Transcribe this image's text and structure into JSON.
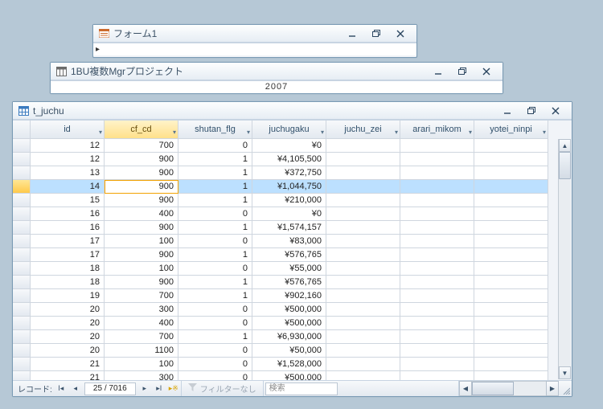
{
  "windows": {
    "form1": {
      "title": "フォーム1"
    },
    "bu": {
      "title": "1BU複数Mgrプロジェクト",
      "stub": "2007"
    },
    "tjuchu": {
      "title": "t_juchu"
    }
  },
  "columns": [
    "id",
    "cf_cd",
    "shutan_flg",
    "juchugaku",
    "juchu_zei",
    "arari_mikom",
    "yotei_ninpi"
  ],
  "active_column_index": 1,
  "selected_row_index": 3,
  "rows": [
    {
      "id": "12",
      "cf_cd": "700",
      "shutan_flg": "0",
      "juchugaku": "¥0",
      "juchu_zei": "",
      "arari_mikom": "",
      "yotei_ninpi": ""
    },
    {
      "id": "12",
      "cf_cd": "900",
      "shutan_flg": "1",
      "juchugaku": "¥4,105,500",
      "juchu_zei": "",
      "arari_mikom": "",
      "yotei_ninpi": ""
    },
    {
      "id": "13",
      "cf_cd": "900",
      "shutan_flg": "1",
      "juchugaku": "¥372,750",
      "juchu_zei": "",
      "arari_mikom": "",
      "yotei_ninpi": ""
    },
    {
      "id": "14",
      "cf_cd": "900",
      "shutan_flg": "1",
      "juchugaku": "¥1,044,750",
      "juchu_zei": "",
      "arari_mikom": "",
      "yotei_ninpi": ""
    },
    {
      "id": "15",
      "cf_cd": "900",
      "shutan_flg": "1",
      "juchugaku": "¥210,000",
      "juchu_zei": "",
      "arari_mikom": "",
      "yotei_ninpi": ""
    },
    {
      "id": "16",
      "cf_cd": "400",
      "shutan_flg": "0",
      "juchugaku": "¥0",
      "juchu_zei": "",
      "arari_mikom": "",
      "yotei_ninpi": ""
    },
    {
      "id": "16",
      "cf_cd": "900",
      "shutan_flg": "1",
      "juchugaku": "¥1,574,157",
      "juchu_zei": "",
      "arari_mikom": "",
      "yotei_ninpi": ""
    },
    {
      "id": "17",
      "cf_cd": "100",
      "shutan_flg": "0",
      "juchugaku": "¥83,000",
      "juchu_zei": "",
      "arari_mikom": "",
      "yotei_ninpi": ""
    },
    {
      "id": "17",
      "cf_cd": "900",
      "shutan_flg": "1",
      "juchugaku": "¥576,765",
      "juchu_zei": "",
      "arari_mikom": "",
      "yotei_ninpi": ""
    },
    {
      "id": "18",
      "cf_cd": "100",
      "shutan_flg": "0",
      "juchugaku": "¥55,000",
      "juchu_zei": "",
      "arari_mikom": "",
      "yotei_ninpi": ""
    },
    {
      "id": "18",
      "cf_cd": "900",
      "shutan_flg": "1",
      "juchugaku": "¥576,765",
      "juchu_zei": "",
      "arari_mikom": "",
      "yotei_ninpi": ""
    },
    {
      "id": "19",
      "cf_cd": "700",
      "shutan_flg": "1",
      "juchugaku": "¥902,160",
      "juchu_zei": "",
      "arari_mikom": "",
      "yotei_ninpi": ""
    },
    {
      "id": "20",
      "cf_cd": "300",
      "shutan_flg": "0",
      "juchugaku": "¥500,000",
      "juchu_zei": "",
      "arari_mikom": "",
      "yotei_ninpi": ""
    },
    {
      "id": "20",
      "cf_cd": "400",
      "shutan_flg": "0",
      "juchugaku": "¥500,000",
      "juchu_zei": "",
      "arari_mikom": "",
      "yotei_ninpi": ""
    },
    {
      "id": "20",
      "cf_cd": "700",
      "shutan_flg": "1",
      "juchugaku": "¥6,930,000",
      "juchu_zei": "",
      "arari_mikom": "",
      "yotei_ninpi": ""
    },
    {
      "id": "20",
      "cf_cd": "1100",
      "shutan_flg": "0",
      "juchugaku": "¥50,000",
      "juchu_zei": "",
      "arari_mikom": "",
      "yotei_ninpi": ""
    },
    {
      "id": "21",
      "cf_cd": "100",
      "shutan_flg": "0",
      "juchugaku": "¥1,528,000",
      "juchu_zei": "",
      "arari_mikom": "",
      "yotei_ninpi": ""
    },
    {
      "id": "21",
      "cf_cd": "300",
      "shutan_flg": "0",
      "juchugaku": "¥500,000",
      "juchu_zei": "",
      "arari_mikom": "",
      "yotei_ninpi": ""
    }
  ],
  "nav": {
    "label": "レコード:",
    "counter": "25 / 7016",
    "filter_label": "フィルターなし",
    "search_placeholder": "検索"
  }
}
